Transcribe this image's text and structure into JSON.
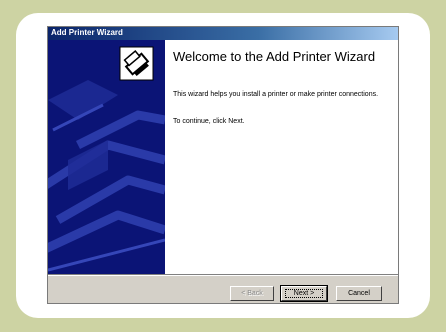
{
  "window": {
    "title": "Add Printer Wizard"
  },
  "content": {
    "heading": "Welcome to the Add Printer Wizard",
    "description": "This wizard helps you install a printer or make printer connections.",
    "instruction": "To continue, click Next."
  },
  "buttons": {
    "back": "< Back",
    "next": "Next >",
    "cancel": "Cancel"
  },
  "colors": {
    "background": "#cdd3a3",
    "sidebar": "#0b1476",
    "titlebar": "#0a246a",
    "button_face": "#d4d0c8"
  },
  "icons": {
    "wizard_icon": "printer-icon"
  }
}
